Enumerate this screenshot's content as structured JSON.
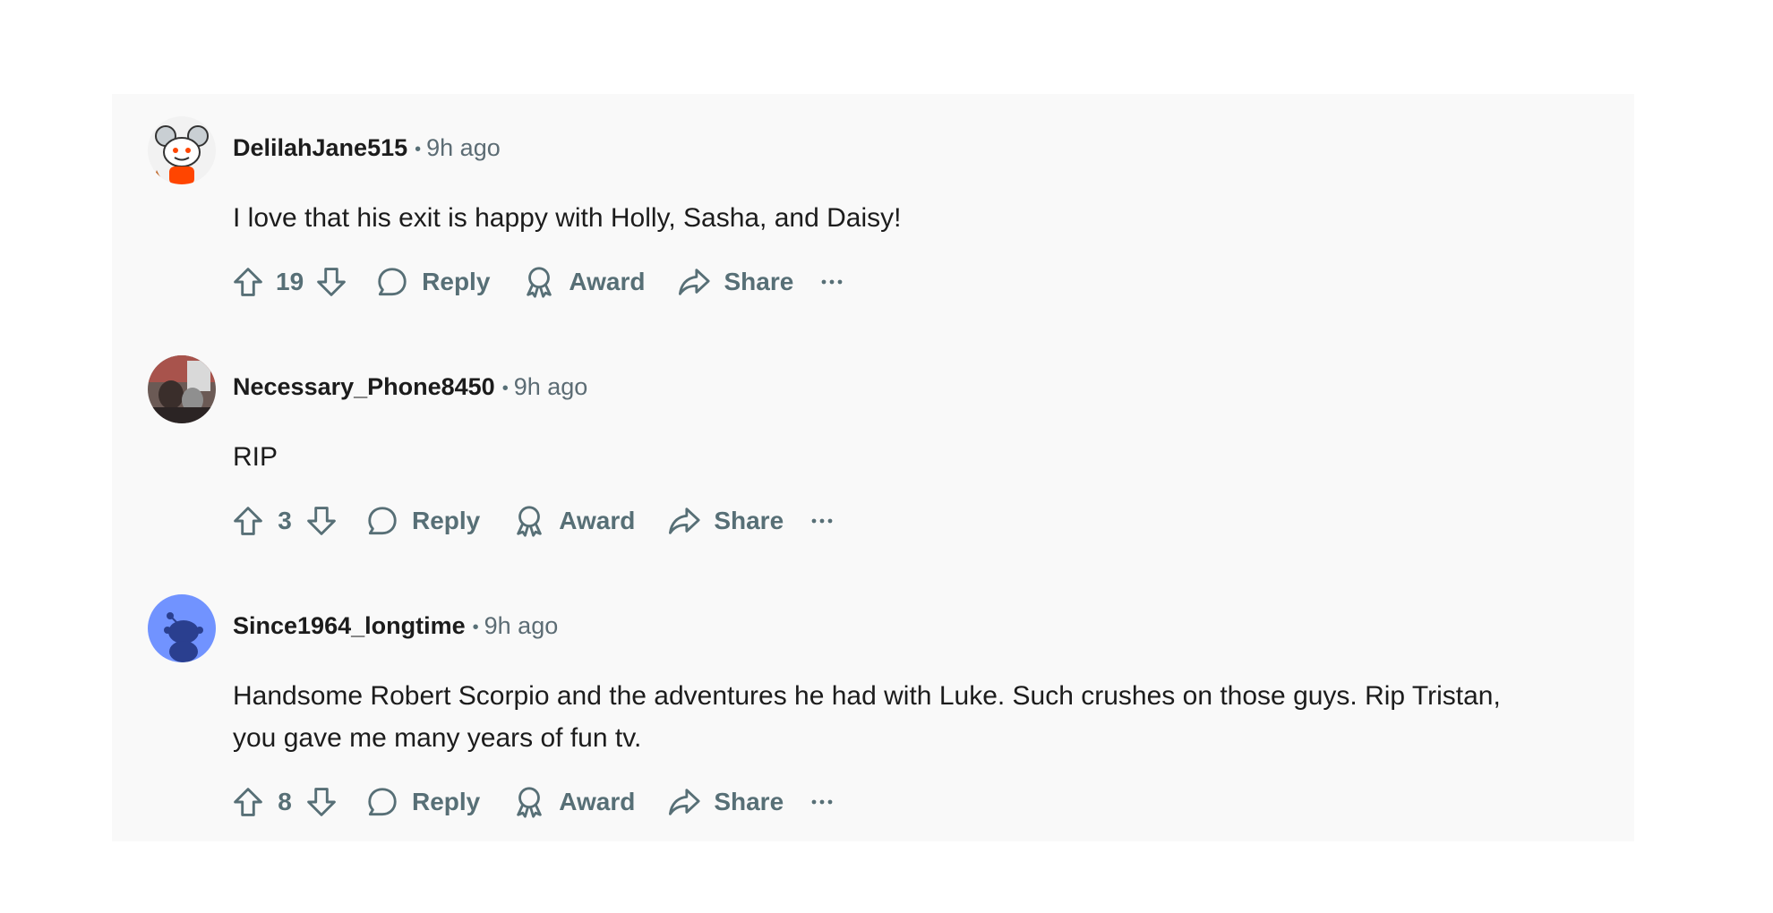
{
  "comments": [
    {
      "author": "DelilahJane515",
      "separator": "•",
      "time": "9h ago",
      "text": "I love that his exit is happy with Holly, Sasha, and Daisy!",
      "score": "19",
      "reply_label": "Reply",
      "award_label": "Award",
      "share_label": "Share",
      "avatar": "snoo-avatar-mouse-ears"
    },
    {
      "author": "Necessary_Phone8450",
      "separator": "•",
      "time": "9h ago",
      "text": "RIP",
      "score": "3",
      "reply_label": "Reply",
      "award_label": "Award",
      "share_label": "Share",
      "avatar": "photo-avatar"
    },
    {
      "author": "Since1964_longtime",
      "separator": "•",
      "time": "9h ago",
      "text": "Handsome Robert Scorpio and the adventures he had with Luke. Such crushes on those guys. Rip Tristan, you gave me many years of fun tv.",
      "score": "8",
      "reply_label": "Reply",
      "award_label": "Award",
      "share_label": "Share",
      "avatar": "default-snoo-avatar"
    }
  ],
  "icons": {
    "upvote": "upvote-arrow-icon",
    "downvote": "downvote-arrow-icon",
    "reply": "speech-bubble-icon",
    "award": "award-ribbon-icon",
    "share": "share-arrow-icon",
    "more": "ellipsis-icon"
  },
  "colors": {
    "panel_bg": "#f9f9f9",
    "text": "#1c1c1c",
    "muted": "#576f76",
    "default_avatar_bg": "#7193ff"
  }
}
